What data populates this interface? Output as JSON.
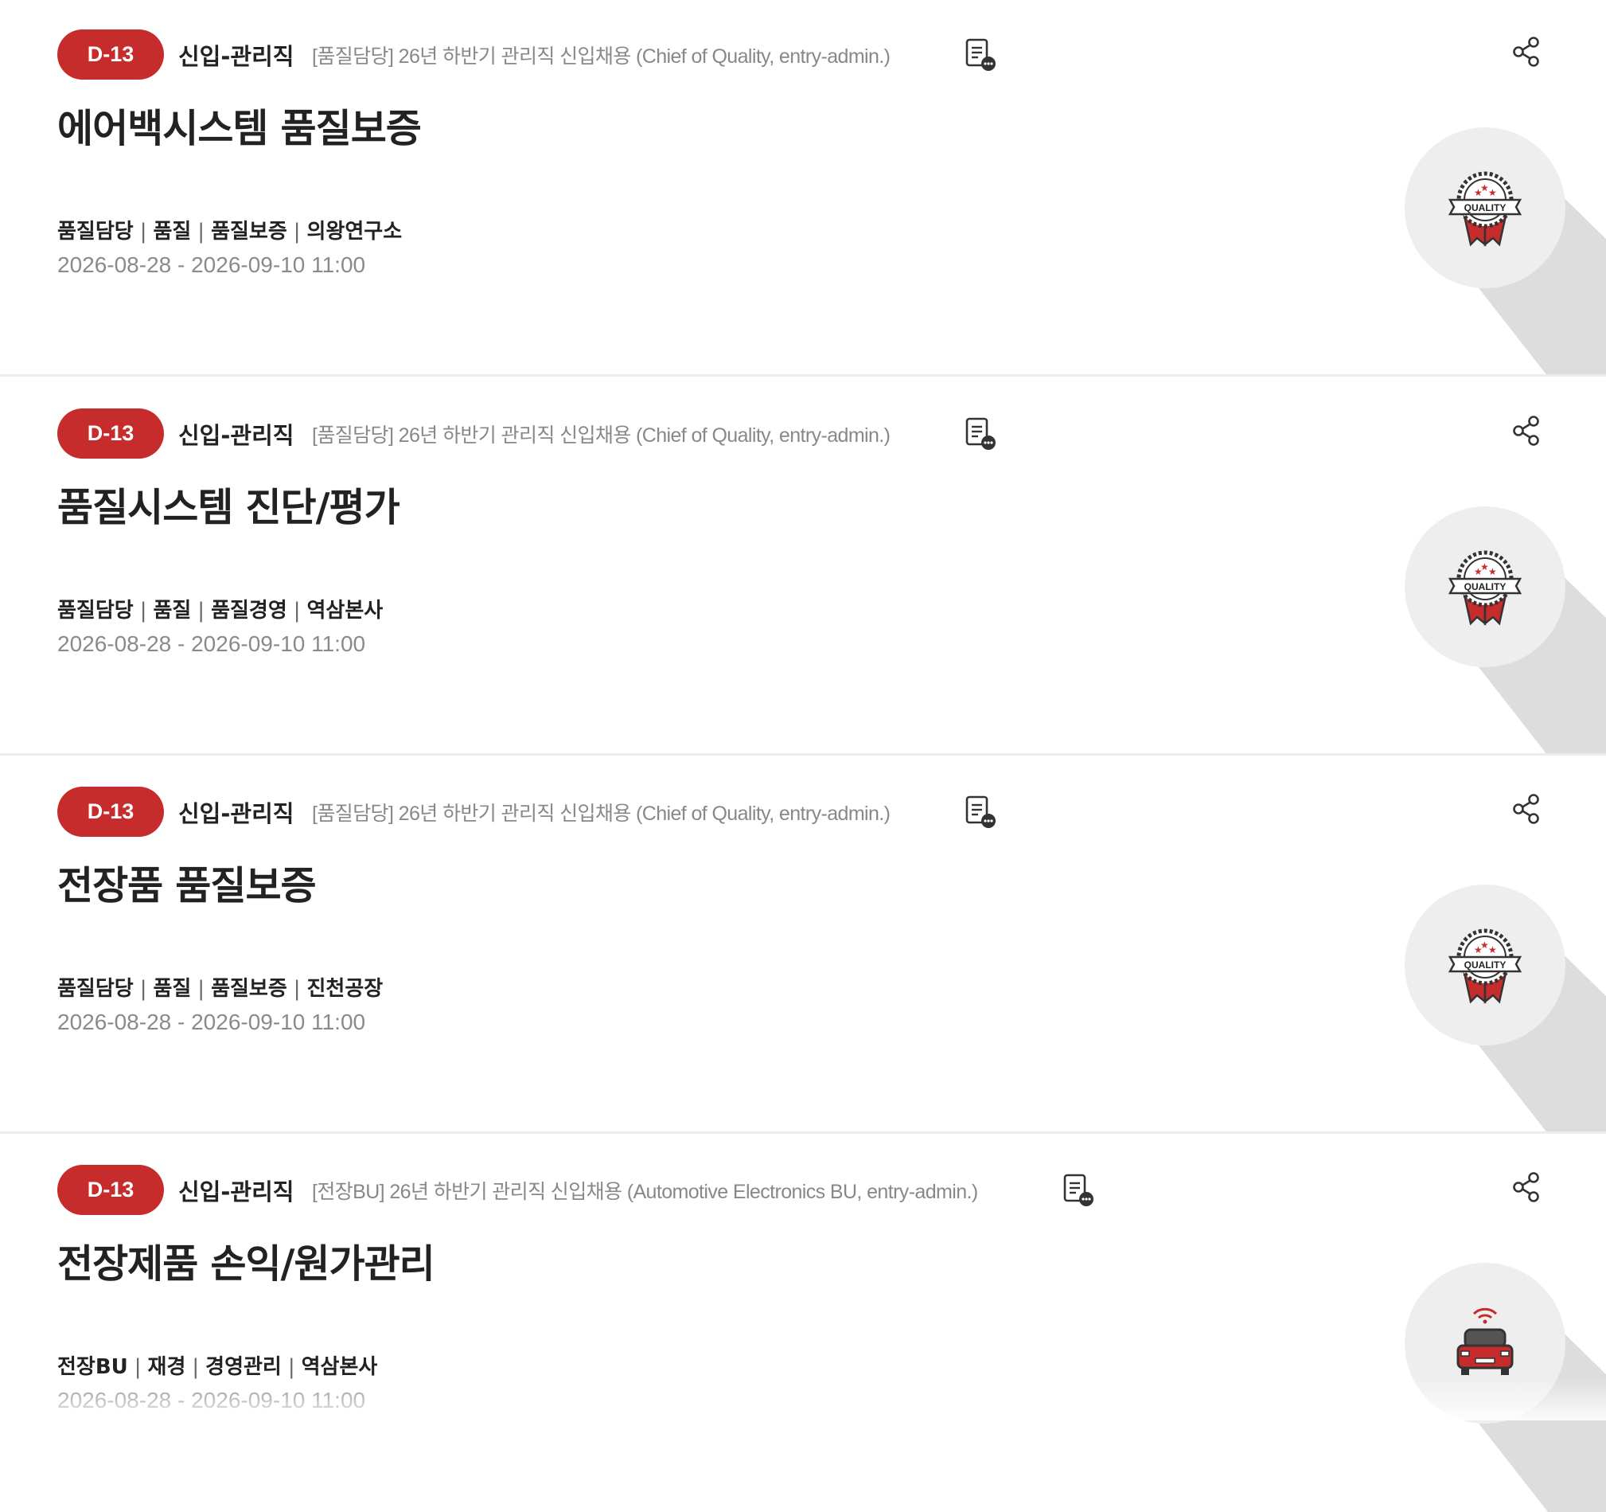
{
  "jobs": [
    {
      "badge": "D-13",
      "type": "신입-관리직",
      "notice": "[품질담당] 26년 하반기 관리직 신입채용 (Chief of Quality, entry-admin.)",
      "title": "에어백시스템 품질보증",
      "tags": [
        "품질담당",
        "품질",
        "품질보증",
        "의왕연구소"
      ],
      "dates": "2026-08-28 - 2026-09-10 11:00",
      "icon": "quality-badge-icon"
    },
    {
      "badge": "D-13",
      "type": "신입-관리직",
      "notice": "[품질담당] 26년 하반기 관리직 신입채용 (Chief of Quality, entry-admin.)",
      "title": "품질시스템 진단/평가",
      "tags": [
        "품질담당",
        "품질",
        "품질경영",
        "역삼본사"
      ],
      "dates": "2026-08-28 - 2026-09-10 11:00",
      "icon": "quality-badge-icon"
    },
    {
      "badge": "D-13",
      "type": "신입-관리직",
      "notice": "[품질담당] 26년 하반기 관리직 신입채용 (Chief of Quality, entry-admin.)",
      "title": "전장품 품질보증",
      "tags": [
        "품질담당",
        "품질",
        "품질보증",
        "진천공장"
      ],
      "dates": "2026-08-28 - 2026-09-10 11:00",
      "icon": "quality-badge-icon"
    },
    {
      "badge": "D-13",
      "type": "신입-관리직",
      "notice": "[전장BU] 26년 하반기 관리직 신입채용 (Automotive Electronics BU, entry-admin.)",
      "title": "전장제품 손익/원가관리",
      "tags": [
        "전장BU",
        "재경",
        "경영관리",
        "역삼본사"
      ],
      "dates": "2026-08-28 - 2026-09-10 11:00",
      "icon": "connected-car-icon"
    }
  ],
  "quality_badge_text": "QUALITY",
  "colors": {
    "accent": "#c72c2d",
    "muted": "#888888",
    "circle": "#eeeeee",
    "shadow": "#dddddd"
  }
}
